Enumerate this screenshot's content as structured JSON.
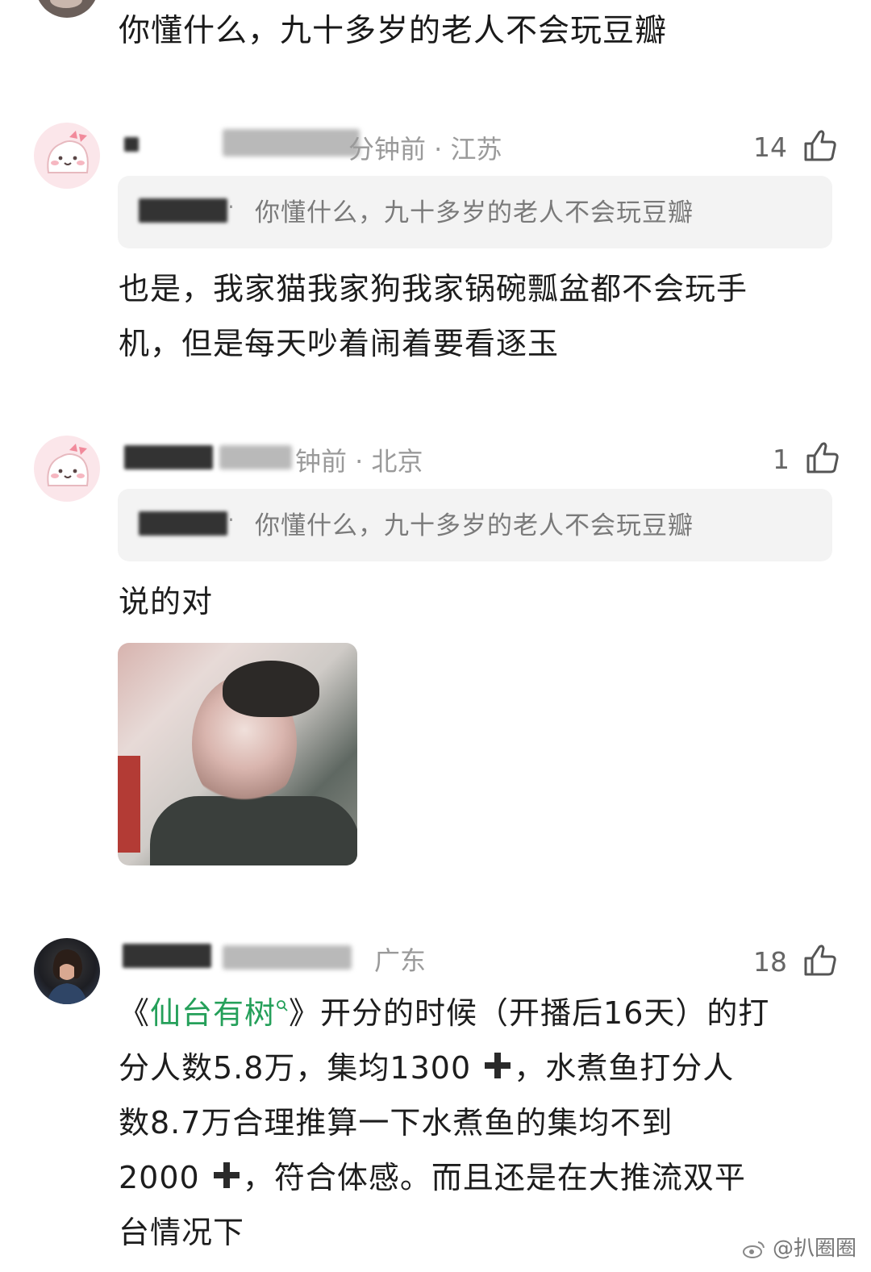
{
  "top_comment": {
    "text": "你懂什么，九十多岁的老人不会玩豆瓣"
  },
  "comments": [
    {
      "meta": "分钟前 · 江苏",
      "likes": "14",
      "quote_text": "你懂什么，九十多岁的老人不会玩豆瓣",
      "body_lines": [
        "也是，我家猫我家狗我家锅碗瓢盆都不会玩手",
        "机，但是每天吵着闹着要看逐玉"
      ]
    },
    {
      "meta": "钟前 · 北京",
      "likes": "1",
      "quote_text": "你懂什么，九十多岁的老人不会玩豆瓣",
      "body": "说的对"
    },
    {
      "meta": "广东",
      "likes": "18",
      "line1_prefix": "《",
      "line1_link": "仙台有树",
      "line1_suffix": "》开分的时候（开播后16天）的打",
      "line2_a": "分人数5.8万，集均1300",
      "line2_b": "，水煮鱼打分人",
      "line3": "数8.7万合理推算一下水煮鱼的集均不到",
      "line4_a": "2000",
      "line4_b": "，符合体感。而且还是在大推流双平",
      "line5": "台情况下"
    }
  ],
  "watermark": "@扒圈圈",
  "icons": {
    "like": "thumbs-up-icon",
    "search_hint": "search-icon",
    "plus": "plus-icon",
    "weibo": "weibo-logo-icon"
  }
}
